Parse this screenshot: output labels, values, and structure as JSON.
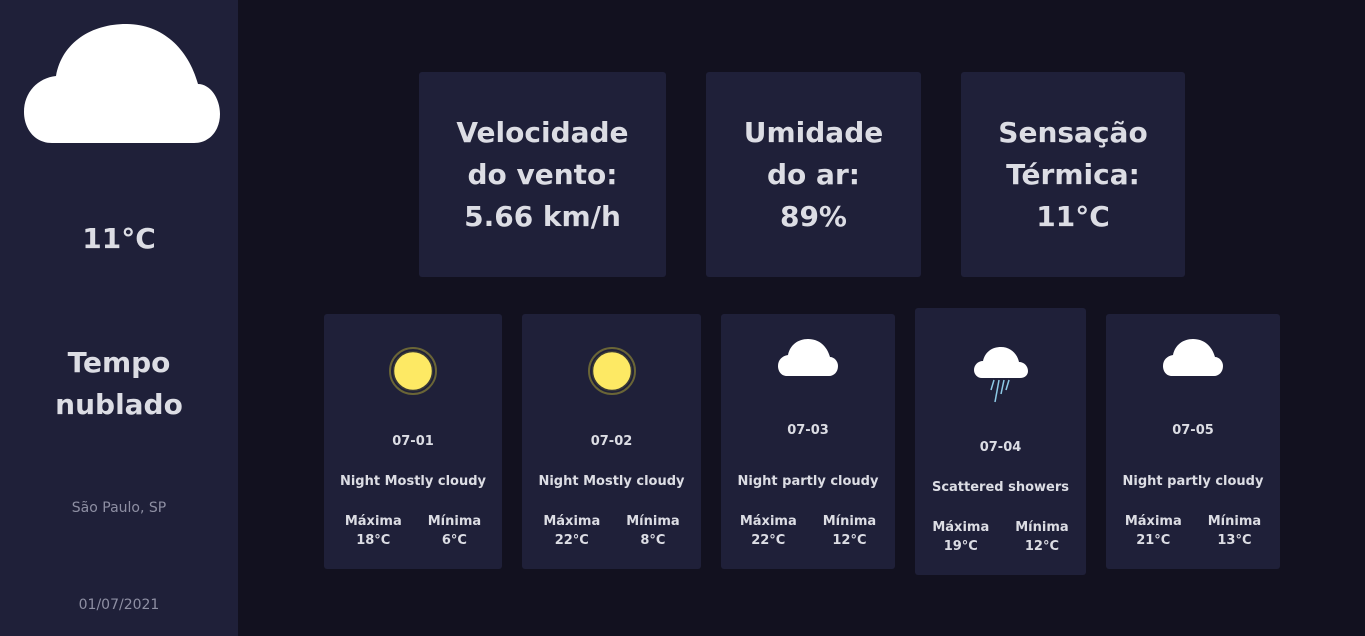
{
  "current": {
    "icon": "cloud-icon",
    "temperature": "11°C",
    "description": "Tempo nublado",
    "city": "São Paulo, SP",
    "date": "01/07/2021"
  },
  "stats": [
    {
      "label": "Velocidade\ndo vento:\n5.66 km/h"
    },
    {
      "label": "Umidade\ndo ar:\n89%"
    },
    {
      "label": "Sensação\nTérmica:\n11°C"
    }
  ],
  "forecast": [
    {
      "day": "07-01",
      "icon": "sun-icon",
      "condition": "Night Mostly cloudy",
      "max_label": "Máxima",
      "max": "18°C",
      "min_label": "Mínima",
      "min": "6°C"
    },
    {
      "day": "07-02",
      "icon": "sun-icon",
      "condition": "Night Mostly cloudy",
      "max_label": "Máxima",
      "max": "22°C",
      "min_label": "Mínima",
      "min": "8°C"
    },
    {
      "day": "07-03",
      "icon": "cloud-icon",
      "condition": "Night partly cloudy",
      "max_label": "Máxima",
      "max": "22°C",
      "min_label": "Mínima",
      "min": "12°C"
    },
    {
      "day": "07-04",
      "icon": "rain-cloud-icon",
      "condition": "Scattered showers",
      "max_label": "Máxima",
      "max": "19°C",
      "min_label": "Mínima",
      "min": "12°C"
    },
    {
      "day": "07-05",
      "icon": "cloud-icon",
      "condition": "Night partly cloudy",
      "max_label": "Máxima",
      "max": "21°C",
      "min_label": "Mínima",
      "min": "13°C"
    }
  ],
  "colors": {
    "background": "#12111f",
    "panel": "#1f2039",
    "text": "#dcdde4",
    "muted": "#8e8fa3",
    "sun": "#fde964"
  }
}
